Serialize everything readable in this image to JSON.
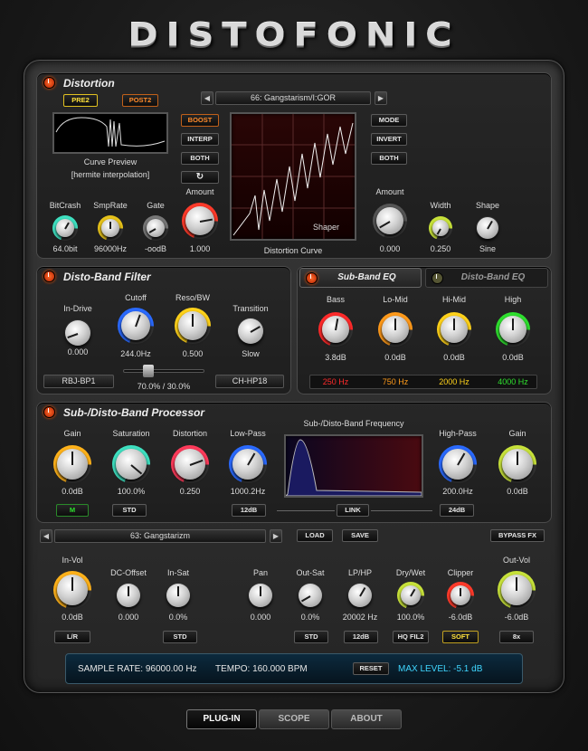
{
  "app": {
    "title": "DISTOFONIC"
  },
  "colors": {
    "accent": "#ff7a1a",
    "power": "#e23a10",
    "freq_low": "#ff2a2a",
    "freq_lowmid": "#ff9a1a",
    "freq_himid": "#ffd21a",
    "freq_high": "#2ee02e",
    "status_text": "#3fd6ff"
  },
  "distortion": {
    "title": "Distortion",
    "pre_label": "PRE2",
    "post_label": "POST2",
    "preset": "66: Gangstarism/I:GOR",
    "curve_preview": "Curve Preview",
    "interp": "[hermite interpolation]",
    "btn_boost": "BOOST",
    "btn_interp": "INTERP",
    "btn_both": "BOTH",
    "btn_refresh": "↻",
    "btn_mode": "MODE",
    "btn_invert": "INVERT",
    "btn_both2": "BOTH",
    "shaper_label": "Shaper",
    "curve_label": "Distortion Curve",
    "knobs": [
      {
        "label": "BitCrash",
        "value": "64.0bit",
        "ring": "#3ee0c0"
      },
      {
        "label": "SmpRate",
        "value": "96000Hz",
        "ring": "#e6c21a"
      },
      {
        "label": "Gate",
        "value": "-oodB",
        "ring": "#777777"
      },
      {
        "label": "Amount",
        "value": "1.000",
        "ring": "#ff3a2a"
      },
      {
        "label": "Amount",
        "value": "0.000",
        "ring": "#555555"
      },
      {
        "label": "Width",
        "value": "0.250",
        "ring": "#c8e23a"
      },
      {
        "label": "Shape",
        "value": "Sine",
        "ring": "#555555"
      }
    ]
  },
  "band_filter": {
    "title": "Disto-Band Filter",
    "filter_type": "RBJ-BP1",
    "slider_text": "70.0% / 30.0%",
    "hp_type": "CH-HP18",
    "knobs": [
      {
        "label": "In-Drive",
        "value": "0.000"
      },
      {
        "label": "Cutoff",
        "value": "244.0Hz"
      },
      {
        "label": "Reso/BW",
        "value": "0.500"
      },
      {
        "label": "Transition",
        "value": "Slow"
      }
    ]
  },
  "eq": {
    "tab_sub": "Sub-Band EQ",
    "tab_disto": "Disto-Band EQ",
    "knobs": [
      {
        "label": "Bass",
        "value": "3.8dB",
        "freq": "250 Hz"
      },
      {
        "label": "Lo-Mid",
        "value": "0.0dB",
        "freq": "750 Hz"
      },
      {
        "label": "Hi-Mid",
        "value": "0.0dB",
        "freq": "2000 Hz"
      },
      {
        "label": "High",
        "value": "0.0dB",
        "freq": "4000 Hz"
      }
    ]
  },
  "processor": {
    "title": "Sub-/Disto-Band Processor",
    "freq_title": "Sub-/Disto-Band Frequency",
    "btn_m": "M",
    "btn_std": "STD",
    "btn_12db": "12dB",
    "btn_link": "LINK",
    "btn_24db": "24dB",
    "knobs": [
      {
        "label": "Gain",
        "value": "0.0dB"
      },
      {
        "label": "Saturation",
        "value": "100.0%"
      },
      {
        "label": "Distortion",
        "value": "0.250"
      },
      {
        "label": "Low-Pass",
        "value": "1000.2Hz"
      },
      {
        "label": "High-Pass",
        "value": "200.0Hz"
      },
      {
        "label": "Gain",
        "value": "0.0dB"
      }
    ]
  },
  "preset_bar": {
    "preset": "63: Gangstarizm",
    "btn_load": "LOAD",
    "btn_save": "SAVE",
    "btn_bypass": "BYPASS FX"
  },
  "output": {
    "knobs": [
      {
        "label": "In-Vol",
        "value": "0.0dB"
      },
      {
        "label": "DC-Offset",
        "value": "0.000"
      },
      {
        "label": "In-Sat",
        "value": "0.0%"
      },
      {
        "label": "Pan",
        "value": "0.000"
      },
      {
        "label": "Out-Sat",
        "value": "0.0%"
      },
      {
        "label": "LP/HP",
        "value": "20002 Hz"
      },
      {
        "label": "Dry/Wet",
        "value": "100.0%"
      },
      {
        "label": "Clipper",
        "value": "-6.0dB"
      },
      {
        "label": "Out-Vol",
        "value": "-6.0dB"
      }
    ],
    "btn_lr": "L/R",
    "btn_std": "STD",
    "btn_std2": "STD",
    "btn_12db": "12dB",
    "btn_hq": "HQ FIL2",
    "btn_soft": "SOFT",
    "btn_8x": "8x"
  },
  "status": {
    "sample_rate": "SAMPLE RATE: 96000.00 Hz",
    "tempo": "TEMPO: 160.000 BPM",
    "btn_reset": "RESET",
    "max_level": "MAX LEVEL: -5.1 dB"
  },
  "tabs": {
    "plugin": "PLUG-IN",
    "scope": "SCOPE",
    "about": "ABOUT"
  }
}
